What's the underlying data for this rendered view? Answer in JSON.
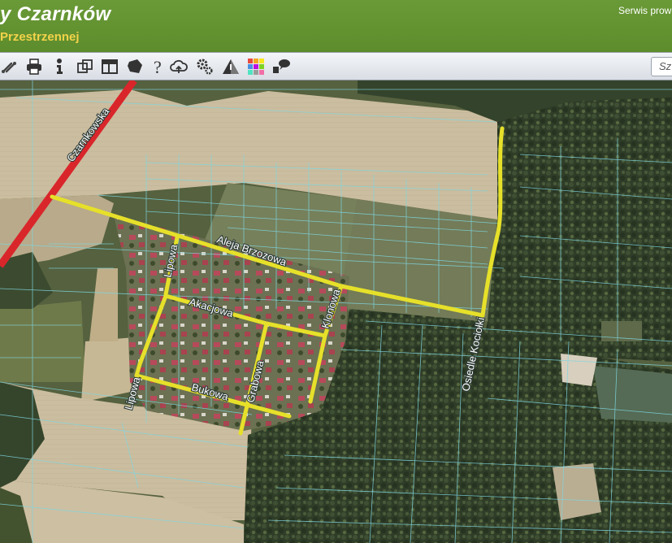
{
  "header": {
    "title": "y Czarnków",
    "subtitle": "Przestrzennej",
    "service_text": "Serwis prowa"
  },
  "toolbar": {
    "tools": [
      {
        "name": "measure-tool-icon"
      },
      {
        "name": "print-icon"
      },
      {
        "name": "info-identify-icon"
      },
      {
        "name": "layers-compare-icon"
      },
      {
        "name": "layout-icon"
      },
      {
        "name": "select-area-icon"
      },
      {
        "name": "help-icon"
      },
      {
        "name": "cloud-upload-icon"
      },
      {
        "name": "settings-gears-icon"
      },
      {
        "name": "warning-icon"
      },
      {
        "name": "color-palette-icon"
      },
      {
        "name": "comment-icon"
      }
    ],
    "search_placeholder": "Sz"
  },
  "map": {
    "street_labels": [
      {
        "id": "czarnkowska",
        "text": "Czarnkowska"
      },
      {
        "id": "aleja-brzozowa",
        "text": "Aleja Brzozowa"
      },
      {
        "id": "lipowa-north",
        "text": "Lipowa"
      },
      {
        "id": "akacjowa",
        "text": "Akacjowa"
      },
      {
        "id": "klonowa",
        "text": "Klonowa"
      },
      {
        "id": "osiedle-kociolki",
        "text": "Osiedle Kociołki"
      },
      {
        "id": "lipowa-south",
        "text": "Lipowa"
      },
      {
        "id": "grabowa",
        "text": "Grabowa"
      },
      {
        "id": "bukowa",
        "text": "Bukowa"
      }
    ],
    "colors": {
      "highlighted_street": "#e6e02a",
      "main_road": "#d9262b",
      "parcel_lines": "#7fd6e0",
      "forest": "#2f3d28",
      "field": "#c9bba0"
    }
  }
}
